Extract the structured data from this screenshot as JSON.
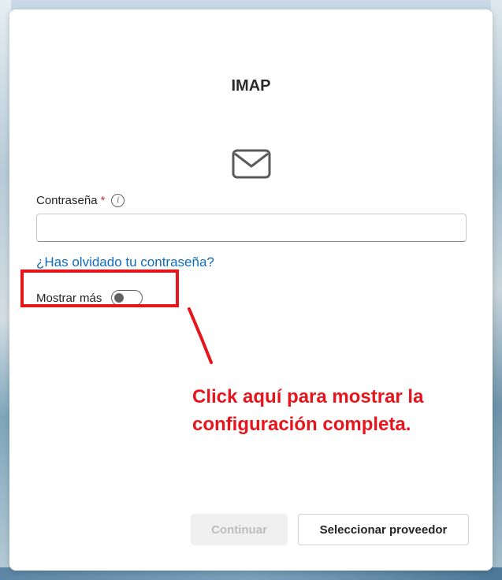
{
  "dialog": {
    "title": "IMAP",
    "icon": "mail-icon",
    "password_label": "Contraseña",
    "required_mark": "*",
    "info_icon": "info-icon",
    "password_value": "",
    "forgot_link": "¿Has olvidado tu contraseña?",
    "show_more_label": "Mostrar más",
    "show_more_state": false,
    "continue_label": "Continuar",
    "provider_label": "Seleccionar proveedor"
  },
  "annotation": {
    "text_line1": "Click aquí para mostrar la",
    "text_line2": "configuración completa.",
    "color": "#e8141c"
  },
  "colors": {
    "link": "#0f6cbd",
    "required": "#c4314b"
  }
}
